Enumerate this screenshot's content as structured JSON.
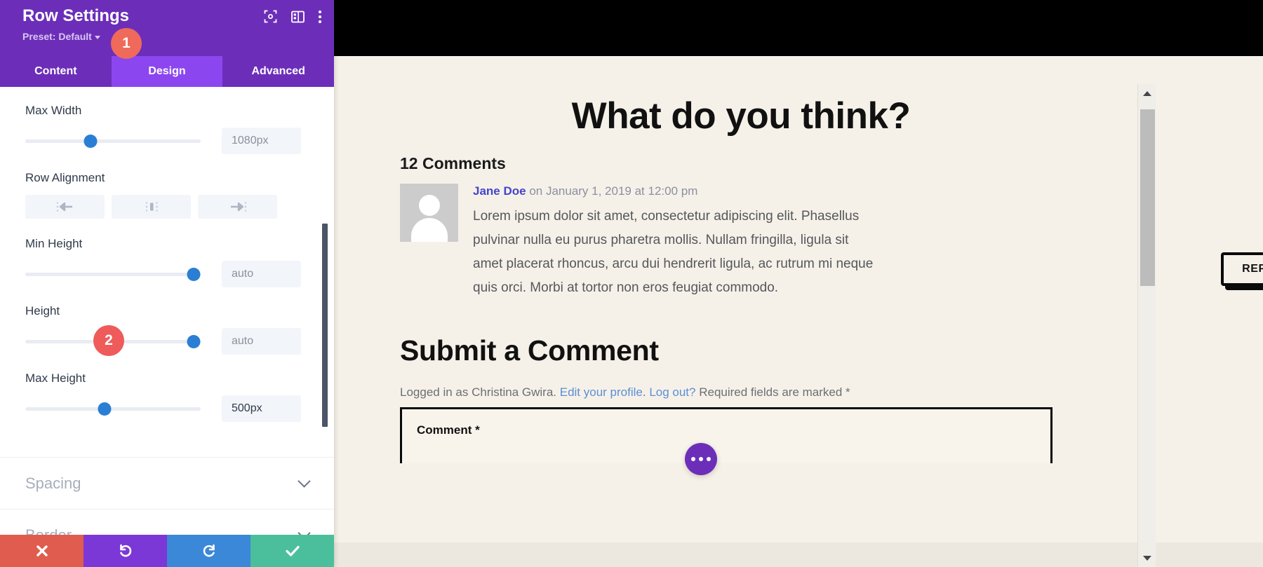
{
  "panel": {
    "title": "Row Settings",
    "preset": "Preset: Default",
    "header_icons": [
      {
        "name": "focus-target-icon"
      },
      {
        "name": "panel-layout-icon"
      },
      {
        "name": "kebab-menu-icon"
      }
    ],
    "tabs": [
      {
        "label": "Content",
        "active": false
      },
      {
        "label": "Design",
        "active": true
      },
      {
        "label": "Advanced",
        "active": false
      }
    ],
    "fields": [
      {
        "label": "Max Width",
        "value": "1080px",
        "placeholder": "1080px",
        "knob_percent": 37,
        "filled": false
      },
      {
        "label": "Min Height",
        "value": "auto",
        "placeholder": "auto",
        "knob_percent": 96,
        "filled": false
      },
      {
        "label": "Height",
        "value": "auto",
        "placeholder": "auto",
        "knob_percent": 96,
        "filled": false
      },
      {
        "label": "Max Height",
        "value": "500px",
        "placeholder": "500px",
        "knob_percent": 45,
        "filled": true
      }
    ],
    "row_alignment": {
      "label": "Row Alignment",
      "options": [
        {
          "name": "align-left-icon"
        },
        {
          "name": "align-center-icon"
        },
        {
          "name": "align-right-icon"
        }
      ]
    },
    "accordions": [
      {
        "label": "Spacing"
      },
      {
        "label": "Border"
      }
    ],
    "actions": [
      {
        "name": "cancel-button",
        "icon": "close-icon"
      },
      {
        "name": "undo-button",
        "icon": "undo-icon"
      },
      {
        "name": "redo-button",
        "icon": "redo-icon"
      },
      {
        "name": "save-button",
        "icon": "check-icon"
      }
    ],
    "step_badges": [
      {
        "number": "1"
      },
      {
        "number": "2"
      }
    ],
    "colors": {
      "header_purple": "#6c2eb9",
      "tab_active_purple": "#8b46f0",
      "slider_blue": "#2a7fd4",
      "badge_red": "#ef6a5a",
      "cancel_red": "#e05c4e",
      "undo_purple": "#7c38d6",
      "redo_blue": "#3b87d8",
      "save_green": "#4bbf9b"
    }
  },
  "preview": {
    "page_title": "What do you think?",
    "comments_count": "12 Comments",
    "comment": {
      "author": "Jane Doe",
      "meta": " on January 1, 2019 at 12:00 pm",
      "body": "Lorem ipsum dolor sit amet, consectetur adipiscing elit. Phasellus pulvinar nulla eu purus pharetra mollis. Nullam fringilla, ligula sit amet placerat rhoncus, arcu dui hendrerit ligula, ac rutrum mi neque quis orci. Morbi at tortor non eros feugiat commodo.",
      "reply_label": "REPLY"
    },
    "submit_title": "Submit a Comment",
    "logged_in": {
      "prefix": "Logged in as Christina Gwira. ",
      "edit_profile": "Edit your profile",
      "mid": ". ",
      "log_out": "Log out?",
      "suffix": " Required fields are marked *"
    },
    "comment_field_label": "Comment *",
    "fab": {
      "name": "more-options-fab"
    },
    "scrollbar": {
      "up": "scroll-up-arrow",
      "down": "scroll-down-arrow"
    },
    "colors": {
      "page_bg": "#f6f1e8",
      "link_blue": "#5b8fd6",
      "author_blue": "#4444cc",
      "fab_purple": "#6c2eb9"
    }
  }
}
